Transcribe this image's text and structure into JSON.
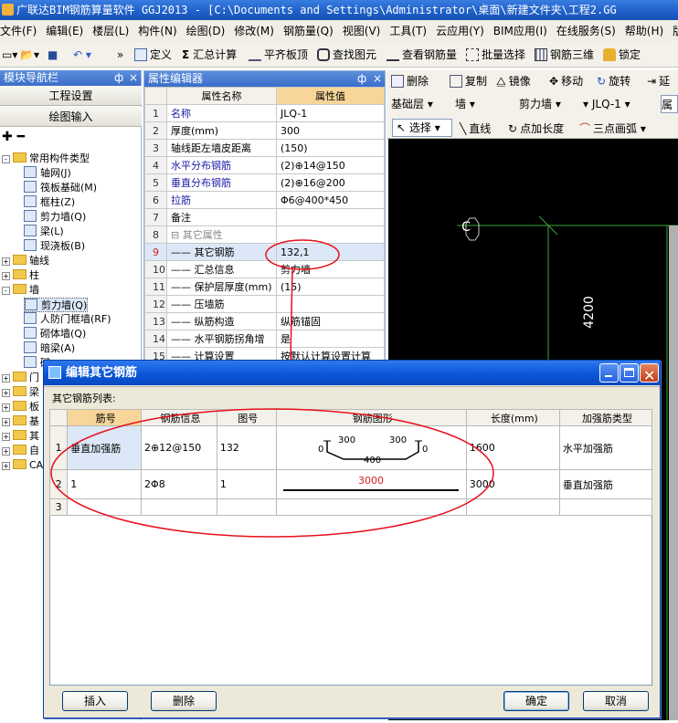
{
  "app": {
    "title": "广联达BIM钢筋算量软件 GGJ2013 - [C:\\Documents and Settings\\Administrator\\桌面\\新建文件夹\\工程2.GG"
  },
  "menu": [
    "文件(F)",
    "编辑(E)",
    "楼层(L)",
    "构件(N)",
    "绘图(D)",
    "修改(M)",
    "钢筋量(Q)",
    "视图(V)",
    "工具(T)",
    "云应用(Y)",
    "BIM应用(I)",
    "在线服务(S)",
    "帮助(H)",
    "版"
  ],
  "toolbar1": {
    "define": "定义",
    "summary": "汇总计算",
    "align_slab": "平齐板顶",
    "find_elem": "查找图元",
    "view_rebar": "查看钢筋量",
    "batch_select": "批量选择",
    "rebar3d": "钢筋三维",
    "lock": "锁定",
    "more": "»"
  },
  "toolbar2": {
    "delete": "删除",
    "copy": "复制",
    "mirror": "镜像",
    "move": "移动",
    "rotate": "旋转",
    "extend": "延"
  },
  "toolbar3": {
    "layer": "基础层",
    "category": "墙",
    "type": "剪力墙",
    "name": "JLQ-1",
    "prop_btn": "属"
  },
  "toolbar4": {
    "select": "选择",
    "line": "直线",
    "point_len": "点加长度",
    "arc3": "三点画弧"
  },
  "nav": {
    "title": "模块导航栏",
    "pin": "ф",
    "close": "×",
    "btn_project": "工程设置",
    "btn_draw": "绘图输入"
  },
  "tree": [
    {
      "label": "常用构件类型",
      "level": 0,
      "exp": "-"
    },
    {
      "label": "轴网(J)",
      "level": 1
    },
    {
      "label": "筏板基础(M)",
      "level": 1
    },
    {
      "label": "框柱(Z)",
      "level": 1
    },
    {
      "label": "剪力墙(Q)",
      "level": 1
    },
    {
      "label": "梁(L)",
      "level": 1
    },
    {
      "label": "现浇板(B)",
      "level": 1
    },
    {
      "label": "轴线",
      "level": 0,
      "exp": "+"
    },
    {
      "label": "柱",
      "level": 0,
      "exp": "+"
    },
    {
      "label": "墙",
      "level": 0,
      "exp": "-"
    },
    {
      "label": "剪力墙(Q)",
      "level": 1,
      "selected": true
    },
    {
      "label": "人防门框墙(RF)",
      "level": 1
    },
    {
      "label": "砌体墙(Q)",
      "level": 1
    },
    {
      "label": "暗梁(A)",
      "level": 1
    },
    {
      "label": "砌",
      "level": 1
    },
    {
      "label": "门",
      "level": 0,
      "exp": "+"
    },
    {
      "label": "梁",
      "level": 0,
      "exp": "+"
    },
    {
      "label": "板",
      "level": 0,
      "exp": "+"
    },
    {
      "label": "基",
      "level": 0,
      "exp": "+"
    },
    {
      "label": "其",
      "level": 0,
      "exp": "+"
    },
    {
      "label": "自",
      "level": 0,
      "exp": "+"
    },
    {
      "label": "CA",
      "level": 0,
      "exp": "+"
    }
  ],
  "props": {
    "title": "属性编辑器",
    "col_name": "属性名称",
    "col_value": "属性值",
    "rows": [
      {
        "n": "1",
        "k": "名称",
        "v": "JLQ-1",
        "blue": true
      },
      {
        "n": "2",
        "k": "厚度(mm)",
        "v": "300"
      },
      {
        "n": "3",
        "k": "轴线距左墙皮距离",
        "v": "(150)"
      },
      {
        "n": "4",
        "k": "水平分布钢筋",
        "v": "(2)⊕14@150",
        "blue": true
      },
      {
        "n": "5",
        "k": "垂直分布钢筋",
        "v": "(2)⊕16@200",
        "blue": true
      },
      {
        "n": "6",
        "k": "拉筋",
        "v": "Φ6@400*450",
        "blue": true
      },
      {
        "n": "7",
        "k": "备注",
        "v": ""
      },
      {
        "n": "8",
        "k": "⊟ 其它属性",
        "v": "",
        "gray": true
      },
      {
        "n": "9",
        "k": "—— 其它钢筋",
        "v": "132,1",
        "sel": true
      },
      {
        "n": "10",
        "k": "—— 汇总信息",
        "v": "剪力墙"
      },
      {
        "n": "11",
        "k": "—— 保护层厚度(mm)",
        "v": "(15)"
      },
      {
        "n": "12",
        "k": "—— 压墙筋",
        "v": ""
      },
      {
        "n": "13",
        "k": "—— 纵筋构造",
        "v": "纵筋锚固"
      },
      {
        "n": "14",
        "k": "—— 水平钢筋拐角增",
        "v": "是"
      },
      {
        "n": "15",
        "k": "—— 计算设置",
        "v": "按默认计算设置计算"
      }
    ]
  },
  "canvas": {
    "axis_label": "C",
    "dimension": "4200"
  },
  "dialog": {
    "title": "编辑其它钢筋",
    "list_label": "其它钢筋列表:",
    "headers": [
      "筋号",
      "钢筋信息",
      "图号",
      "钢筋图形",
      "长度(mm)",
      "加强筋类型"
    ],
    "rows": [
      {
        "n": "1",
        "bar": "垂直加强筋",
        "info": "2⊕12@150",
        "fig": "132",
        "shape": {
          "a": "0",
          "b": "300",
          "c": "300",
          "d": "0",
          "e": "400"
        },
        "len": "1600",
        "type": "水平加强筋"
      },
      {
        "n": "2",
        "bar": "1",
        "info": "2Φ8",
        "fig": "1",
        "shape": {
          "len_label": "3000"
        },
        "len": "3000",
        "type": "垂直加强筋"
      },
      {
        "n": "3",
        "bar": "",
        "info": "",
        "fig": "",
        "len": "",
        "type": ""
      }
    ],
    "btn_insert": "插入",
    "btn_delete": "删除",
    "btn_ok": "确定",
    "btn_cancel": "取消"
  },
  "colors": {
    "annotation": "#e8101c",
    "title_blue": "#1d5fc8",
    "selected_row": "#dce8f8"
  }
}
